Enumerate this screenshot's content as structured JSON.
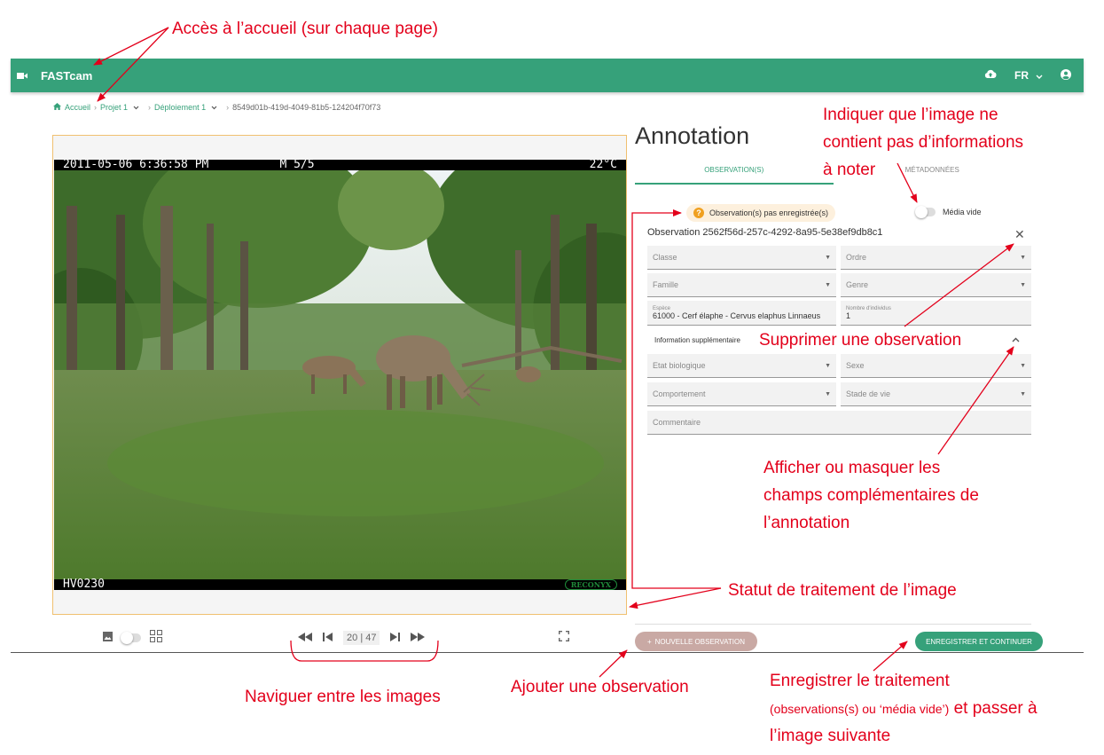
{
  "app": {
    "title": "FASTcam",
    "language": "FR",
    "icons": {
      "logo": "video-camera-icon",
      "cloud": "cloud-upload-icon",
      "account": "account-circle-icon"
    }
  },
  "breadcrumb": {
    "home": "Accueil",
    "project": "Projet 1",
    "deployment": "Déploiement 1",
    "media_id": "8549d01b-419d-4049-81b5-124204f70f73"
  },
  "camera_overlay": {
    "timestamp": "2011-05-06 6:36:58 PM",
    "moon": "M 5/5",
    "temperature": "22°C",
    "camera_id": "HV0230",
    "brand": "RECONYX"
  },
  "navigation": {
    "current": "20",
    "total": "47",
    "separator": "|"
  },
  "annotation": {
    "title": "Annotation",
    "tab_observations": "OBSERVATION(S)",
    "tab_metadata": "MÉTADONNÉES",
    "status_badge": "Observation(s) pas enregistrée(s)",
    "status_badge_glyph": "?",
    "media_vide_label": "Média vide",
    "observation_label": "Observation 2562f56d-257c-4292-8a95-5e38ef9db8c1",
    "close_glyph": "✕",
    "fields": {
      "classe": "Classe",
      "ordre": "Ordre",
      "famille": "Famille",
      "genre": "Genre",
      "espece_label": "Espèce",
      "espece_value": "61000 - Cerf élaphe - Cervus elaphus Linnaeus",
      "nombre_label": "Nombre d'individus",
      "nombre_value": "1",
      "info_supp": "Information supplémentaire",
      "etat_biologique": "Etat biologique",
      "sexe": "Sexe",
      "comportement": "Comportement",
      "stade_de_vie": "Stade de vie",
      "commentaire": "Commentaire"
    },
    "btn_new_observation": "NOUVELLE OBSERVATION",
    "btn_new_plus": "+",
    "btn_save_continue": "ENREGISTRER ET CONTINUER"
  },
  "callouts": {
    "home_access": "Accès à l’accueil (sur chaque page)",
    "empty_media_1": "Indiquer que l’image ne",
    "empty_media_2": "contient pas d’informations",
    "empty_media_3": "à noter",
    "delete_obs": "Supprimer une observation",
    "toggle_fields_1": "Afficher ou masquer les",
    "toggle_fields_2": "champs complémentaires de",
    "toggle_fields_3": "l’annotation",
    "status": "Statut de traitement de l’image",
    "navigate": "Naviguer entre les images",
    "add_obs": "Ajouter une observation",
    "save_1": "Enregistrer le traitement",
    "save_2_small": "(observations(s) ou ‘média vide’)",
    "save_2_rest": " et passer à",
    "save_3": "l’image suivante"
  },
  "colors": {
    "accent": "#36a17a",
    "callout": "#e3001b",
    "badge_bg": "#fdf0dd",
    "badge_icon": "#f0a020",
    "new_obs_button": "#c9a9a4"
  }
}
